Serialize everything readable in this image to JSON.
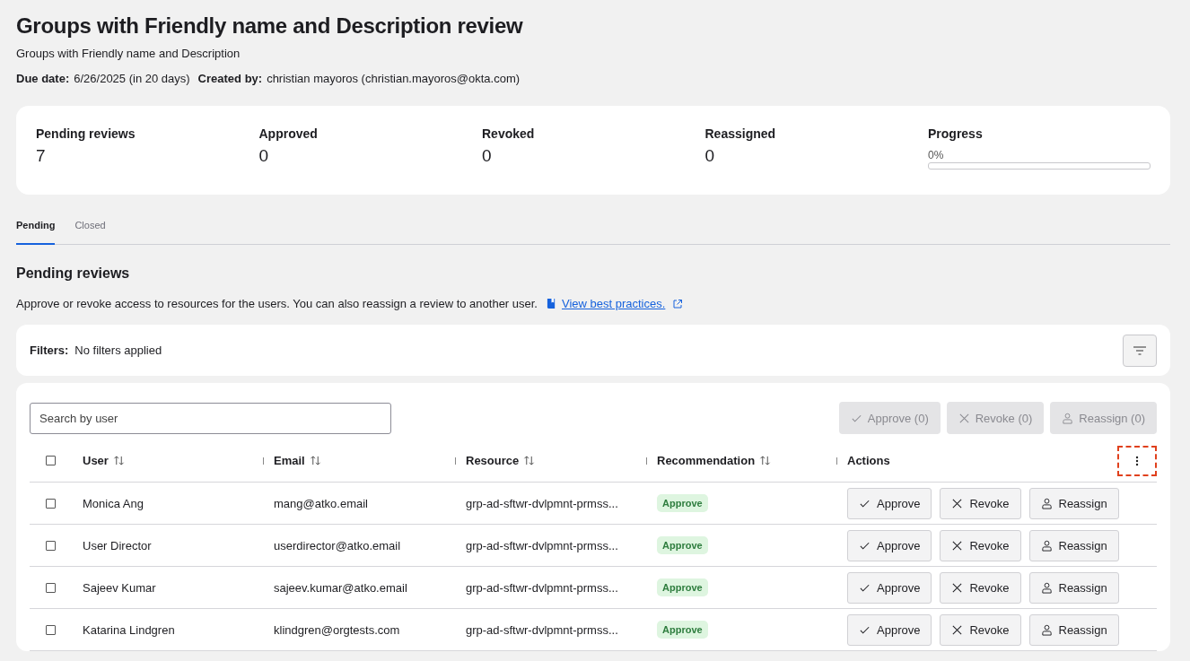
{
  "title": "Groups with Friendly name and Description review",
  "subtitle": "Groups with Friendly name and Description",
  "meta": [
    {
      "label": "Due date:",
      "value": "6/26/2025 (in 20 days)"
    },
    {
      "label": "Created by:",
      "value": "christian mayoros (christian.mayoros@okta.com)"
    }
  ],
  "stats": [
    {
      "label": "Pending reviews",
      "value": "7"
    },
    {
      "label": "Approved",
      "value": "0"
    },
    {
      "label": "Revoked",
      "value": "0"
    },
    {
      "label": "Reassigned",
      "value": "0"
    }
  ],
  "progress": {
    "label": "Progress",
    "reading": "0%",
    "level": 0
  },
  "tabs": [
    {
      "label": "Pending",
      "selected": true
    },
    {
      "label": "Closed",
      "selected": false
    }
  ],
  "section": {
    "title": "Pending reviews",
    "description": "Approve or revoke access to resources for the users. You can also reassign a review to another user.",
    "link": "View best practices."
  },
  "filters": {
    "label": "Filters:",
    "value": "No filters applied"
  },
  "search": {
    "placeholder": "Search by user"
  },
  "bulk_actions": [
    {
      "kind": "approve",
      "label": "Approve (0)",
      "disabled": true
    },
    {
      "kind": "revoke",
      "label": "Revoke (0)",
      "disabled": true
    },
    {
      "kind": "reassign",
      "label": "Reassign (0)",
      "disabled": true
    }
  ],
  "table": {
    "select_all": {
      "checked": false
    },
    "columns": [
      {
        "label": "User",
        "sortable": true
      },
      {
        "label": "Email",
        "sortable": true
      },
      {
        "label": "Resource",
        "sortable": true
      },
      {
        "label": "Recommendation",
        "sortable": true
      },
      {
        "label": "Actions",
        "sortable": false
      }
    ],
    "column_menu": {
      "highlighted": true
    },
    "rows": [
      {
        "checked": false,
        "user": "Monica Ang",
        "email": "mang@atko.email",
        "resource": "grp-ad-sftwr-dvlpmnt-prmss...",
        "recommendation": "Approve",
        "actions": [
          {
            "kind": "approve",
            "label": "Approve"
          },
          {
            "kind": "revoke",
            "label": "Revoke"
          },
          {
            "kind": "reassign",
            "label": "Reassign"
          }
        ]
      },
      {
        "checked": false,
        "user": "User Director",
        "email": "userdirector@atko.email",
        "resource": "grp-ad-sftwr-dvlpmnt-prmss...",
        "recommendation": "Approve",
        "actions": [
          {
            "kind": "approve",
            "label": "Approve"
          },
          {
            "kind": "revoke",
            "label": "Revoke"
          },
          {
            "kind": "reassign",
            "label": "Reassign"
          }
        ]
      },
      {
        "checked": false,
        "user": "Sajeev Kumar",
        "email": "sajeev.kumar@atko.email",
        "resource": "grp-ad-sftwr-dvlpmnt-prmss...",
        "recommendation": "Approve",
        "actions": [
          {
            "kind": "approve",
            "label": "Approve"
          },
          {
            "kind": "revoke",
            "label": "Revoke"
          },
          {
            "kind": "reassign",
            "label": "Reassign"
          }
        ]
      },
      {
        "checked": false,
        "user": "Katarina Lindgren",
        "email": "klindgren@orgtests.com",
        "resource": "grp-ad-sftwr-dvlpmnt-prmss...",
        "recommendation": "Approve",
        "actions": [
          {
            "kind": "approve",
            "label": "Approve"
          },
          {
            "kind": "revoke",
            "label": "Revoke"
          },
          {
            "kind": "reassign",
            "label": "Reassign"
          }
        ]
      }
    ]
  }
}
